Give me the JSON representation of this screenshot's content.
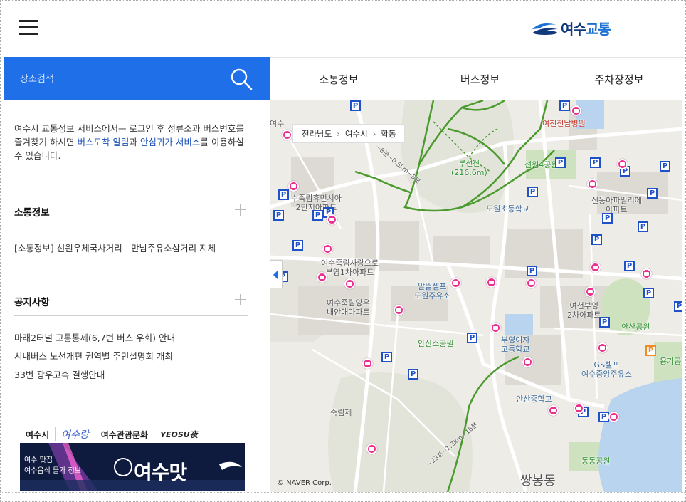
{
  "header": {
    "menu_icon": "hamburger-menu-icon",
    "logo_text_main": "여수",
    "logo_text_accent": "교통",
    "logo_colors": {
      "primary": "#123a7a",
      "accent": "#1a6fd4"
    }
  },
  "search": {
    "placeholder": "장소검색",
    "icon": "search-icon",
    "background": "#1f6fe8"
  },
  "tabs": [
    {
      "label": "소통정보"
    },
    {
      "label": "버스정보"
    },
    {
      "label": "주차장정보"
    }
  ],
  "panel": {
    "intro": {
      "part1": "여수시 교통정보 서비스에서는 로그인 후 정류소과 버스번호를 즐겨찾기 하시면 ",
      "highlight1": "버스도착 알림",
      "part2": "과 ",
      "highlight2": "안심귀가 서비스",
      "part3": "를 이용하실 수 있습니다."
    },
    "traffic": {
      "title": "소통정보",
      "items": [
        "[소통정보] 선원우체국사거리 - 만남주유소삼거리 지체"
      ]
    },
    "notices": {
      "title": "공지사항",
      "items": [
        "마래2터널 교통통제(6,7번 버스 우회) 안내",
        "시내버스 노선개편 권역별 주민설명회 개최",
        "33번 광우고속 결행안내"
      ]
    },
    "banner_tabs": [
      "여수시",
      "여수랑",
      "여수관광문화",
      "YEOSU夜"
    ],
    "banner": {
      "subtitle_line1": "여수 맛집",
      "subtitle_line2": "여수음식 물가 정보",
      "title": "여수맛"
    }
  },
  "map": {
    "breadcrumb": [
      "전라남도",
      "여수시",
      "학동"
    ],
    "copyright": "© NAVER Corp.",
    "labels": {
      "yeocheon_hospital": "여천전남병원",
      "buseonsan": "부선산",
      "buseonsan_height": "(216.6m)",
      "seonwon_park": "선원4공원",
      "jukrim_humansia": "수죽림휴먼시아",
      "jukrim_humansia_2": "2단지아파트",
      "dowon_school": "도원초등학교",
      "sindong_apt": "신동아파밀리에",
      "sindong_apt_2": "아파트",
      "jukrim_sarang": "여수죽림사랑으로",
      "jukrim_sarang_2": "부영1차아파트",
      "alttl_self": "알뜰셀프",
      "dowon_gas": "도원주유소",
      "yeocheon_buyoung": "여천부영",
      "yeocheon_buyoung_2": "2차아파트",
      "jukrim_yangwoo": "여수죽림양우",
      "jukrim_yangwoo_2": "내안애아파트",
      "ansan_park": "안산공원",
      "ansanso_park": "안산소공원",
      "buyoung_girls": "부영여자",
      "buyoung_girls_2": "고등학교",
      "gs_self": "GS셀프",
      "jungang_gas": "여수중앙주유소",
      "yonggi_park": "용기공원",
      "ansan_middle": "안산중학교",
      "jukrimje": "죽림제",
      "dongdong_park": "동동공원",
      "ssangbong": "쌍봉동",
      "trail1": "~8분~0.5km~8분",
      "trail2": "~23분~1.3km~16분",
      "yeosu_top": "여수"
    },
    "colors": {
      "land": "#eeece7",
      "water": "#b8d4ef",
      "park": "#c8dfb8",
      "trail": "#4a9a2e",
      "bus": "#e9308f",
      "parking": "#1f52c8"
    }
  }
}
